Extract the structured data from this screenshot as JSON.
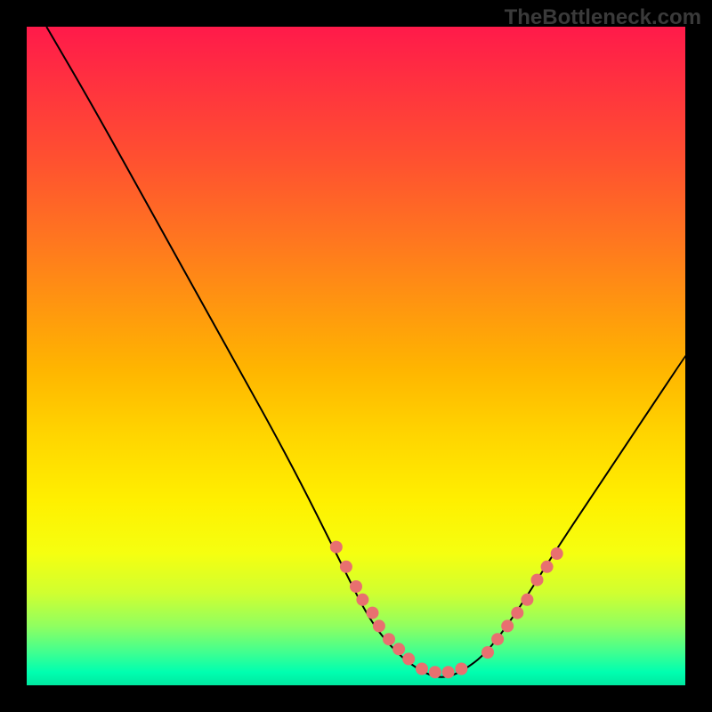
{
  "watermark": "TheBottleneck.com",
  "chart_data": {
    "type": "line",
    "title": "",
    "xlabel": "",
    "ylabel": "",
    "xlim": [
      0,
      100
    ],
    "ylim": [
      0,
      100
    ],
    "series": [
      {
        "name": "curve",
        "x": [
          3,
          10,
          20,
          30,
          40,
          48,
          52,
          56,
          60,
          63,
          66,
          70,
          75,
          80,
          88,
          100
        ],
        "y": [
          100,
          88,
          70,
          52,
          34,
          18,
          10,
          5,
          2,
          1,
          2,
          5,
          12,
          20,
          32,
          50
        ]
      }
    ],
    "markers": {
      "left_cluster": {
        "x": [
          47,
          48.5,
          50,
          51,
          52.5,
          53.5,
          55,
          56.5,
          58,
          60,
          62,
          64,
          66
        ],
        "y": [
          21,
          18,
          15,
          13,
          11,
          9,
          7,
          5.5,
          4,
          2.5,
          2,
          2,
          2.5
        ]
      },
      "right_cluster": {
        "x": [
          70,
          71.5,
          73,
          74.5,
          76,
          77.5,
          79,
          80.5
        ],
        "y": [
          5,
          7,
          9,
          11,
          13,
          16,
          18,
          20
        ]
      }
    },
    "gradient_stops": [
      {
        "pos": 0,
        "color": "#ff1a4a"
      },
      {
        "pos": 20,
        "color": "#ff5030"
      },
      {
        "pos": 42,
        "color": "#ff9510"
      },
      {
        "pos": 62,
        "color": "#ffd500"
      },
      {
        "pos": 80,
        "color": "#f5ff10"
      },
      {
        "pos": 95,
        "color": "#40ff90"
      },
      {
        "pos": 100,
        "color": "#00e8a0"
      }
    ]
  }
}
